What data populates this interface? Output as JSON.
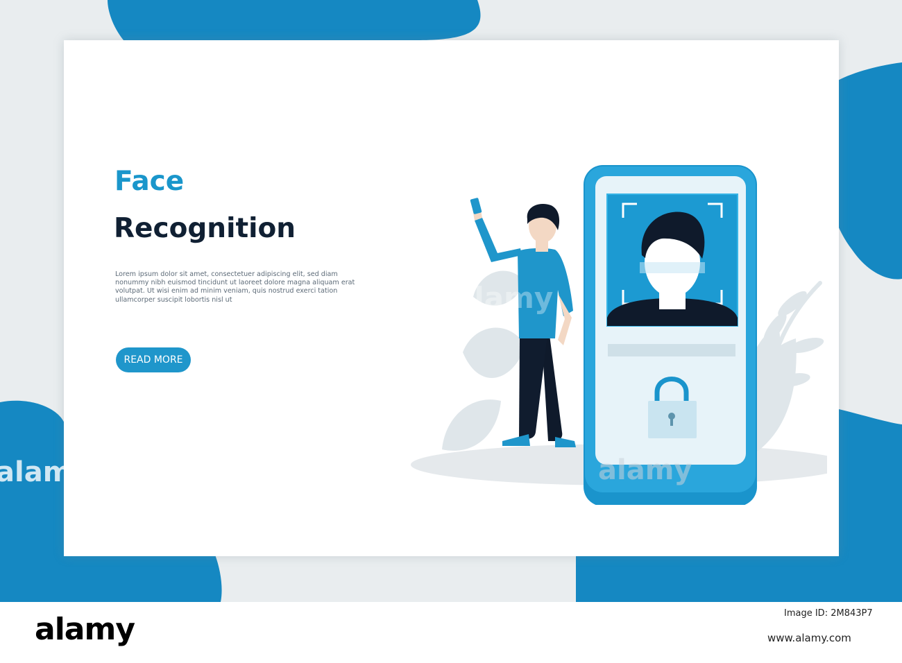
{
  "hero": {
    "title_line1": "Face",
    "title_line2": "Recognition",
    "description": "Lorem ipsum dolor sit amet, consectetuer adipiscing elit, sed diam nonummy nibh euismod tincidunt ut laoreet dolore magna aliquam erat volutpat. Ut wisi enim ad minim veniam, quis nostrud exerci tation ullamcorper suscipit lobortis nisl ut",
    "read_more_label": "READ MORE"
  },
  "watermark": {
    "text": "alamy"
  },
  "footer": {
    "logo_text": "alamy",
    "image_id": "Image ID: 2M843P7",
    "url": "www.alamy.com"
  },
  "colors": {
    "accent": "#1f96cb",
    "title_dark": "#102033",
    "backdrop": "#e9edef",
    "blob_blue": "#1588c2"
  }
}
